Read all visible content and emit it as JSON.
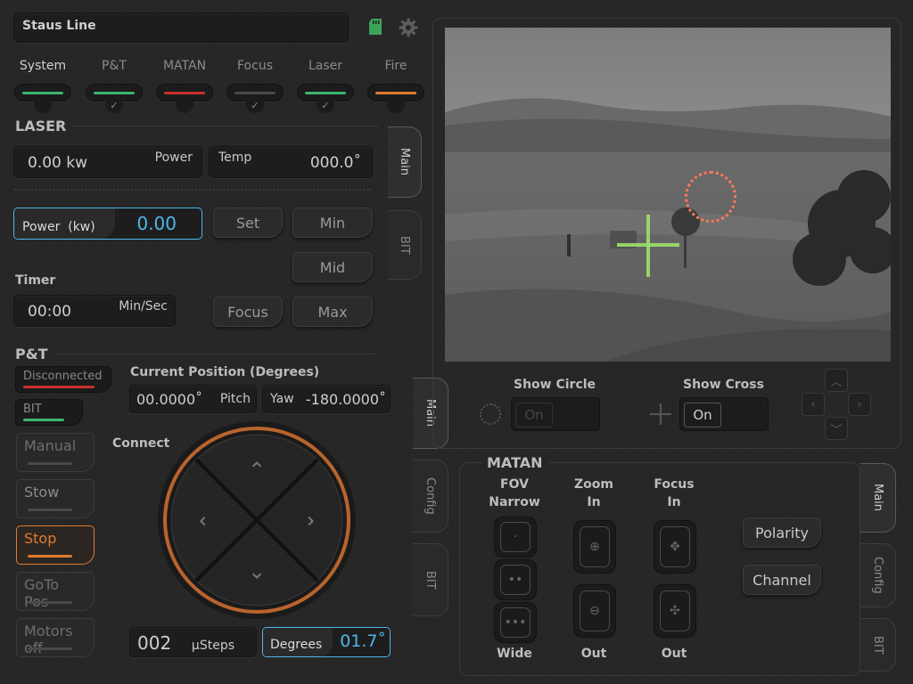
{
  "status_line": "Staus Line",
  "status_tabs": [
    {
      "label": "System",
      "color": "#3db56d",
      "checked": false
    },
    {
      "label": "P&T",
      "color": "#3db56d",
      "checked": true
    },
    {
      "label": "MATAN",
      "color": "#c9302c",
      "checked": false
    },
    {
      "label": "Focus",
      "color": "#4a4a4a",
      "checked": true
    },
    {
      "label": "Laser",
      "color": "#3db56d",
      "checked": true
    },
    {
      "label": "Fire",
      "color": "#e07a2f",
      "checked": false
    }
  ],
  "icons": {
    "sd_card": "sd-card-icon",
    "settings": "gear-icon"
  },
  "laser": {
    "title": "LASER",
    "power_value": "0.00 kw",
    "power_label": "Power",
    "temp_label": "Temp",
    "temp_value": "000.0˚",
    "power_input_label": "Power  (kw)",
    "power_input_value": "0.00",
    "set": "Set",
    "min": "Min",
    "mid": "Mid",
    "focus": "Focus",
    "max": "Max",
    "timer_title": "Timer",
    "timer_value": "00:00",
    "timer_unit": "Min/Sec",
    "tabs": {
      "main": "Main",
      "bit": "BIT"
    }
  },
  "pt": {
    "title": "P&T",
    "disconnected": "Disconnected",
    "bit": "BIT",
    "modes": [
      "Manual",
      "Stow",
      "Stop",
      "GoTo Pos",
      "Motors off"
    ],
    "active_mode": "Stop",
    "current_position_title": "Current Position (Degrees)",
    "pitch_value": "00.0000˚",
    "pitch_label": "Pitch",
    "yaw_label": "Yaw",
    "yaw_value": "-180.0000˚",
    "connect": "Connect",
    "steps_value": "002",
    "steps_unit": "μSteps",
    "degrees_label": "Degrees",
    "degrees_value": "01.7˚",
    "tabs": {
      "main": "Main",
      "config": "Config",
      "bit": "BIT"
    }
  },
  "overlay": {
    "show_circle": "Show Circle",
    "circle_state": "On",
    "show_cross": "Show Cross",
    "cross_state": "On"
  },
  "matan": {
    "title": "MATAN",
    "fov_label": "FOV",
    "fov_top": "Narrow",
    "fov_bottom": "Wide",
    "zoom_label": "Zoom",
    "zoom_top": "In",
    "zoom_bottom": "Out",
    "focus_label": "Focus",
    "focus_top": "In",
    "focus_bottom": "Out",
    "polarity": "Polarity",
    "channel": "Channel",
    "tabs": {
      "main": "Main",
      "config": "Config",
      "bit": "BIT"
    }
  },
  "colors": {
    "accent_orange": "#e07a2f",
    "accent_blue": "#4fb6e8",
    "green": "#3db56d",
    "red": "#c9302c",
    "crosshair": "#9be06a",
    "circle": "#ff7a59"
  }
}
